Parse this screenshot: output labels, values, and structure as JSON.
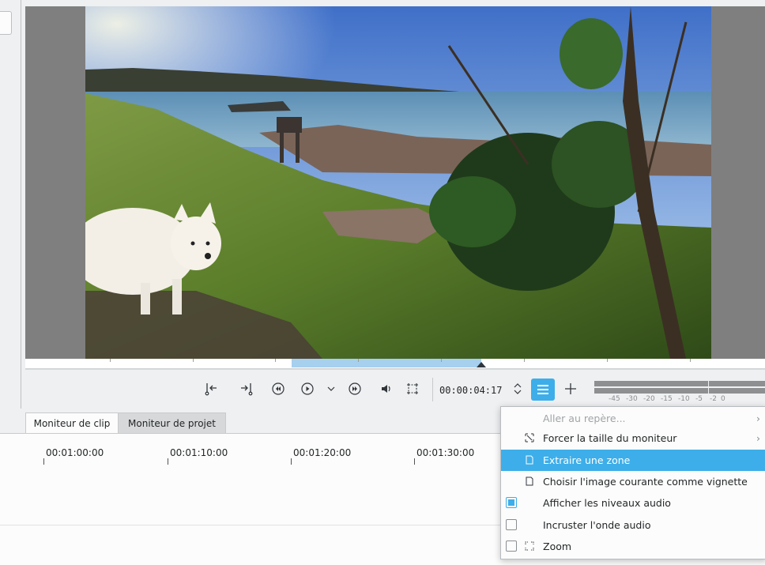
{
  "controls": {
    "timecode": "00:00:04:17"
  },
  "meter": {
    "labels": [
      "-45",
      "-30",
      "-20",
      "-15",
      "-10",
      "-5",
      "-2",
      "0"
    ]
  },
  "tabs": {
    "clip_monitor": "Moniteur de clip",
    "project_monitor": "Moniteur de projet"
  },
  "timeline": {
    "labels": [
      "00:01:00:00",
      "00:01:10:00",
      "00:01:20:00",
      "00:01:30:00"
    ]
  },
  "menu": {
    "items": [
      {
        "label": "Aller au repère...",
        "disabled": true,
        "submenu": true
      },
      {
        "label": "Forcer la taille du moniteur",
        "icon": "resize-icon",
        "submenu": true
      },
      {
        "label": "Extraire une zone",
        "icon": "extract-zone-icon",
        "highlighted": true
      },
      {
        "label": "Choisir l'image courante comme vignette",
        "icon": "thumbnail-icon"
      },
      {
        "label": "Afficher les niveaux audio",
        "checkbox": true,
        "checked": true
      },
      {
        "label": "Incruster l'onde audio",
        "checkbox": true,
        "checked": false
      },
      {
        "label": "Zoom",
        "checkbox": true,
        "checked": false,
        "icon": "zoom-icon"
      }
    ]
  },
  "colors": {
    "accent": "#3daee9",
    "zone": "#a7cfee"
  }
}
